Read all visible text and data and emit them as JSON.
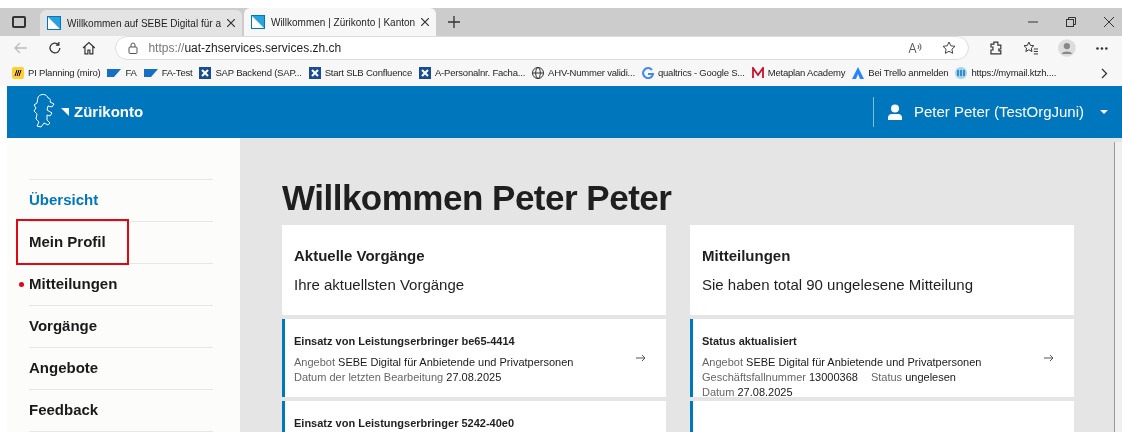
{
  "browser": {
    "tabs": [
      {
        "title": "Willkommen auf SEBE Digital für a",
        "selected": false
      },
      {
        "title": "Willkommen | Zürikonto | Kanton",
        "selected": true
      }
    ],
    "address": {
      "prefix": "https://",
      "host": "uat-zhservices.services.zh.ch"
    },
    "bookmarks": [
      {
        "label": "PI Planning (miro)"
      },
      {
        "label": "FA"
      },
      {
        "label": "FA-Test"
      },
      {
        "label": "SAP Backend (SAP..."
      },
      {
        "label": "Start SLB Confluence"
      },
      {
        "label": "A-Personalnr. Facha..."
      },
      {
        "label": "AHV-Nummer validi..."
      },
      {
        "label": "qualtrics - Google S..."
      },
      {
        "label": "Metaplan Academy"
      },
      {
        "label": "Bei Trello anmelden"
      },
      {
        "label": "https://mymail.ktzh...."
      }
    ]
  },
  "header": {
    "brand": "Zürikonto",
    "user": "Peter Peter (TestOrgJuni)"
  },
  "sidebar": {
    "items": [
      {
        "label": "Übersicht",
        "selected": true,
        "unread": false,
        "highlighted": false
      },
      {
        "label": "Mein Profil",
        "selected": false,
        "unread": false,
        "highlighted": true
      },
      {
        "label": "Mitteilungen",
        "selected": false,
        "unread": true,
        "highlighted": false
      },
      {
        "label": "Vorgänge",
        "selected": false,
        "unread": false,
        "highlighted": false
      },
      {
        "label": "Angebote",
        "selected": false,
        "unread": false,
        "highlighted": false
      },
      {
        "label": "Feedback",
        "selected": false,
        "unread": false,
        "highlighted": false
      }
    ]
  },
  "main": {
    "title": "Willkommen Peter Peter",
    "columns": [
      {
        "heading": "Aktuelle Vorgänge",
        "subheading": "Ihre aktuellsten Vorgänge",
        "items": [
          {
            "kind": "entry",
            "title": "Einsatz von Leistungserbringer be65-4414",
            "lines": [
              [
                {
                  "label": "Angebot",
                  "value": "SEBE Digital für Anbietende und Privatpersonen"
                }
              ],
              [
                {
                  "label": "Datum der letzten Bearbeitung",
                  "value": "27.08.2025"
                }
              ]
            ]
          },
          {
            "kind": "entry",
            "title": "Einsatz von Leistungserbringer 5242-40e0"
          }
        ]
      },
      {
        "heading": "Mitteilungen",
        "subheading": "Sie haben total 90 ungelesene Mitteilung",
        "items": [
          {
            "kind": "entry",
            "title": "Status aktualisiert",
            "lines": [
              [
                {
                  "label": "Angebot",
                  "value": "SEBE Digital für Anbietende und Privatpersonen"
                }
              ],
              [
                {
                  "label": "Geschäftsfallnummer",
                  "value": "13000368"
                },
                {
                  "label": "Status",
                  "value": "ungelesen"
                }
              ],
              [
                {
                  "label": "Datum",
                  "value": "27.08.2025"
                }
              ]
            ]
          },
          {
            "kind": "cut_off"
          }
        ]
      }
    ]
  }
}
